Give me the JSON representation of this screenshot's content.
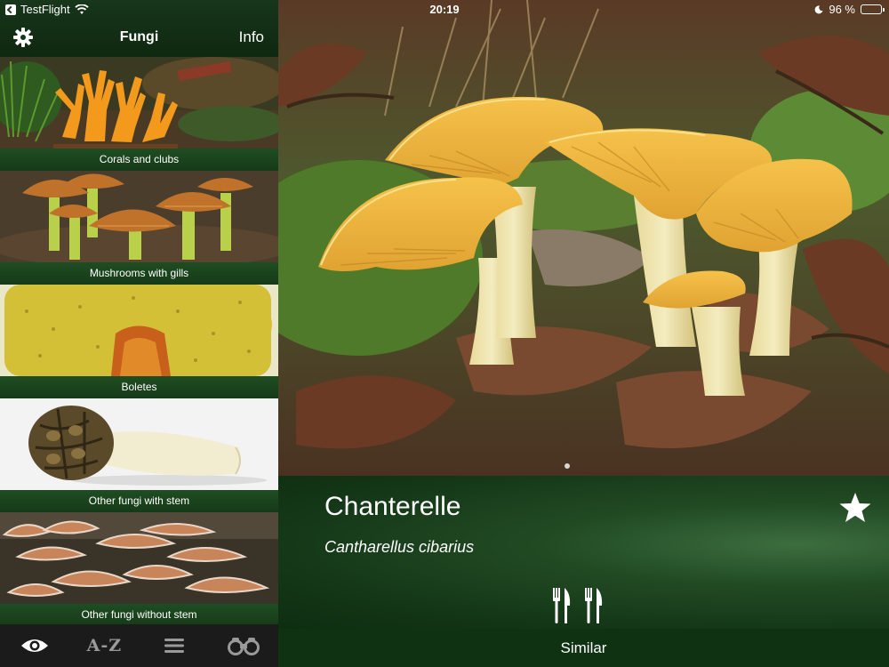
{
  "status": {
    "app_back": "TestFlight",
    "time": "20:19",
    "battery": "96 %",
    "battery_level": 0.96
  },
  "left_nav": {
    "title": "Fungi",
    "info_label": "Info",
    "settings_icon": "gear-icon"
  },
  "categories": [
    {
      "label": "Corals and clubs"
    },
    {
      "label": "Mushrooms with gills"
    },
    {
      "label": "Boletes"
    },
    {
      "label": "Other fungi with stem"
    },
    {
      "label": "Other fungi without stem"
    }
  ],
  "tabbar": {
    "items": [
      {
        "icon": "eye-icon",
        "active": true
      },
      {
        "label": "A-Z",
        "active": false
      },
      {
        "icon": "list-icon",
        "active": false
      },
      {
        "icon": "binoculars-icon",
        "active": false
      }
    ]
  },
  "detail": {
    "common_name": "Chanterelle",
    "latin_name": "Cantharellus cibarius",
    "favorite_icon": "star-icon",
    "edibility_icons": [
      "fork-knife-icon",
      "fork-knife-icon"
    ],
    "similar_label": "Similar"
  },
  "colors": {
    "nav_green": "#17361a",
    "info_green": "#214a23",
    "tabbar_bg": "#1b1b1b",
    "chanterelle_yellow": "#f0b23c"
  }
}
